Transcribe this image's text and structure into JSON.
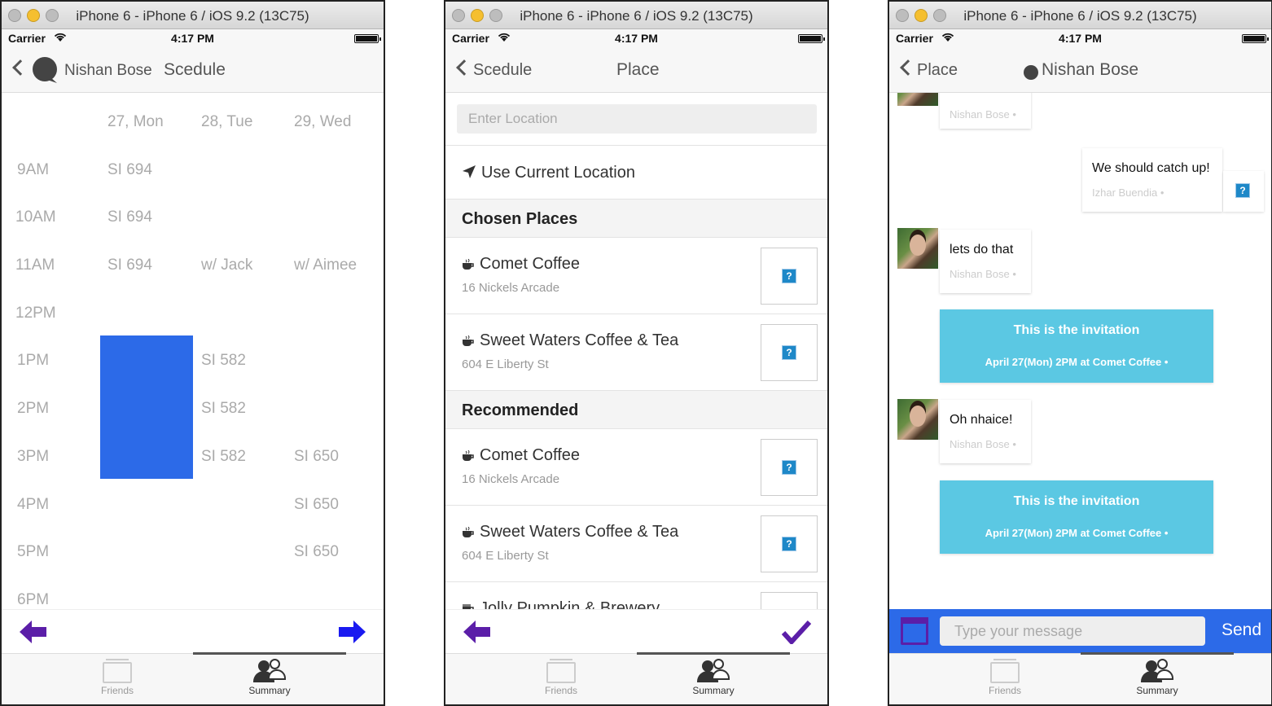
{
  "window_title": "iPhone 6 - iPhone 6 / iOS 9.2 (13C75)",
  "status": {
    "carrier": "Carrier",
    "time": "4:17 PM"
  },
  "tabs": {
    "friends": "Friends",
    "summary": "Summary"
  },
  "colors": {
    "accent_blue": "#2c6ae8",
    "purple": "#5b1ea8",
    "invite_blue": "#5bc8e3",
    "busy_block": "#2c6ae8"
  },
  "screen1": {
    "nav": {
      "name": "Nishan Bose",
      "title": "Scedule"
    },
    "days": [
      "27, Mon",
      "28, Tue",
      "29, Wed"
    ],
    "slots": [
      "9AM",
      "10AM",
      "11AM",
      "12PM",
      "1PM",
      "2PM",
      "3PM",
      "4PM",
      "5PM",
      "6PM"
    ],
    "cells": {
      "mon": [
        "SI 694",
        "SI 694",
        "SI 694"
      ],
      "tue": [
        "w/ Jack",
        "SI 582",
        "SI 582",
        "SI 582"
      ],
      "wed": [
        "w/ Aimee",
        "SI 650",
        "SI 650",
        "SI 650"
      ]
    },
    "busy_block": {
      "day": "27, Mon",
      "from": "12:30PM",
      "to": "3:30PM"
    },
    "icons": {
      "back": "left-arrow-icon",
      "forward": "right-arrow-icon"
    }
  },
  "screen2": {
    "nav": {
      "back": "Scedule",
      "title": "Place"
    },
    "search_placeholder": "Enter Location",
    "current_location": "Use Current Location",
    "sections": {
      "chosen": "Chosen Places",
      "recommended": "Recommended"
    },
    "chosen": [
      {
        "name": "Comet Coffee",
        "address": "16 Nickels Arcade"
      },
      {
        "name": "Sweet Waters Coffee & Tea",
        "address": "604 E Liberty St"
      }
    ],
    "recommended": [
      {
        "name": "Comet Coffee",
        "address": "16 Nickels Arcade"
      },
      {
        "name": "Sweet Waters Coffee & Tea",
        "address": "604 E Liberty St"
      },
      {
        "name": "Jolly Pumpkin & Brewery",
        "address": ""
      }
    ]
  },
  "screen3": {
    "nav": {
      "back": "Place",
      "title": "Nishan Bose"
    },
    "messages": [
      {
        "text": "",
        "sender": "Nishan Bose •"
      },
      {
        "text": "We should catch up!",
        "sender": "Izhar Buendia •"
      },
      {
        "text": "lets do that",
        "sender": "Nishan Bose •"
      },
      {
        "text": "Oh nhaice!",
        "sender": "Nishan Bose •"
      }
    ],
    "invitations": [
      {
        "title": "This is the invitation",
        "detail": "April 27(Mon) 2PM at Comet Coffee •"
      },
      {
        "title": "This is the invitation",
        "detail": "April 27(Mon) 2PM at Comet Coffee •"
      }
    ],
    "composer": {
      "placeholder": "Type your message",
      "send": "Send"
    }
  }
}
